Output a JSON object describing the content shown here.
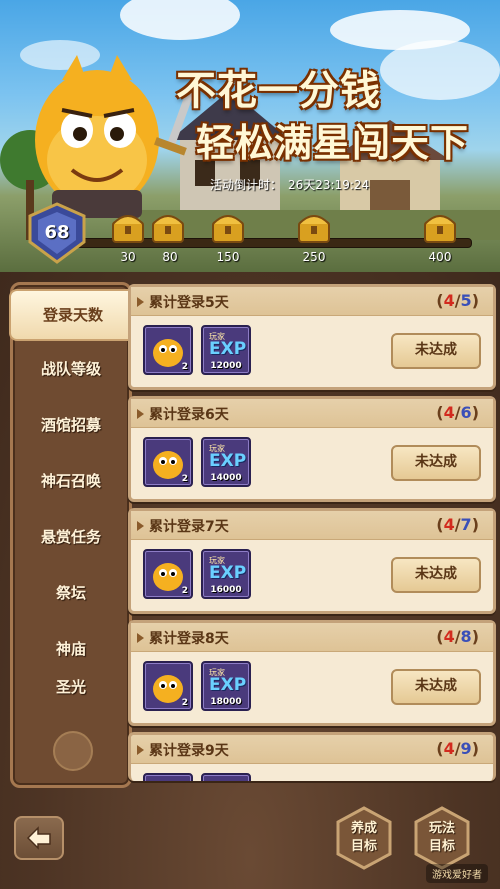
{
  "banner": {
    "title_line1": "不花一分钱",
    "title_line2": "轻松满星闯天下",
    "countdown_label": "活动倒计时：",
    "countdown_value": "26天23:19:24",
    "player_level": "68",
    "milestones": [
      "30",
      "80",
      "150",
      "250",
      "400"
    ]
  },
  "sidebar": {
    "items": [
      {
        "label": "登录天数",
        "active": true
      },
      {
        "label": "战队等级"
      },
      {
        "label": "酒馆招募"
      },
      {
        "label": "神石召唤"
      },
      {
        "label": "悬赏任务"
      },
      {
        "label": "祭坛"
      },
      {
        "label": "神庙"
      },
      {
        "label": "圣光"
      }
    ]
  },
  "cards": [
    {
      "title": "累计登录5天",
      "current": "4",
      "total": "5",
      "item_qty": "2",
      "exp_top": "玩家",
      "exp_label": "EXP",
      "exp_qty": "12000",
      "status": "未达成"
    },
    {
      "title": "累计登录6天",
      "current": "4",
      "total": "6",
      "item_qty": "2",
      "exp_top": "玩家",
      "exp_label": "EXP",
      "exp_qty": "14000",
      "status": "未达成"
    },
    {
      "title": "累计登录7天",
      "current": "4",
      "total": "7",
      "item_qty": "2",
      "exp_top": "玩家",
      "exp_label": "EXP",
      "exp_qty": "16000",
      "status": "未达成"
    },
    {
      "title": "累计登录8天",
      "current": "4",
      "total": "8",
      "item_qty": "2",
      "exp_top": "玩家",
      "exp_label": "EXP",
      "exp_qty": "18000",
      "status": "未达成"
    },
    {
      "title": "累计登录9天",
      "current": "4",
      "total": "9"
    }
  ],
  "bottom": {
    "nurture_line1": "养成",
    "nurture_line2": "目标",
    "gameplay_line1": "玩法",
    "gameplay_line2": "目标"
  },
  "watermark": "游戏爱好者"
}
